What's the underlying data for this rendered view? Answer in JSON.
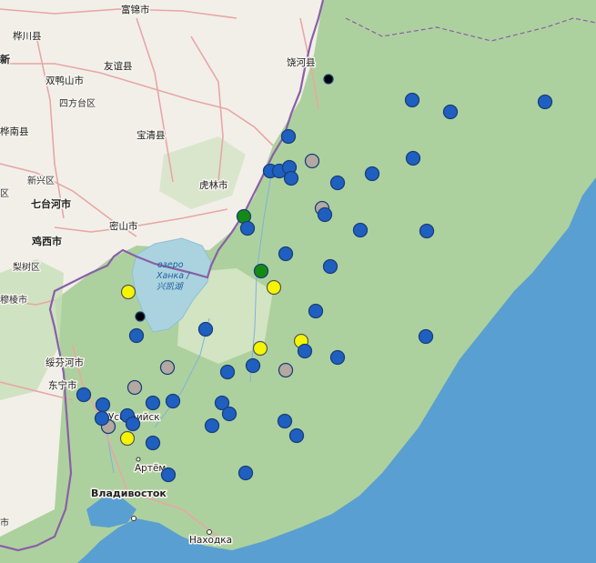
{
  "map": {
    "labels": {
      "fujin": "富锦市",
      "huachuan": "桦川县",
      "shuangyashan_a": "新",
      "youyi": "友谊县",
      "shuangyashan": "双鸭山市",
      "sifangtai": "四方台区",
      "huanan": "桦南县",
      "baoqing": "宝清县",
      "xinxing": "新兴区",
      "qitaihe": "七台河市",
      "qitaihe_a": "区",
      "hulin": "虎林市",
      "mishan": "密山市",
      "jixi": "鸡西市",
      "lishu": "梨树区",
      "muling": "穆棱市",
      "raohe": "饶河县",
      "suifenhe": "绥芬河市",
      "dongning": "东宁市",
      "ussuriysk": "Уссурийск",
      "artem": "Артём",
      "vladivostok": "Владивосток",
      "nakhodka": "Находка",
      "lake_line1": "озеро",
      "lake_line2": "Ханка /",
      "lake_line3": "兴凯湖",
      "edge_shi": "市"
    },
    "colors": {
      "land": "#f2efe9",
      "forest": "#add19e",
      "sea": "#5a9fd1",
      "lake": "#aad3df",
      "border": "#8a5fa8",
      "road": "#e8a6a6",
      "marker_blue": "#1f5fbf",
      "marker_grey": "#b3a9a1",
      "marker_yellow": "#f5f500",
      "marker_green": "#138a13",
      "marker_black": "#000000"
    },
    "markers": [
      {
        "type": "blue"
      },
      {
        "type": "blue"
      },
      {
        "type": "blue"
      },
      {
        "type": "blue"
      },
      {
        "type": "blue"
      },
      {
        "type": "grey"
      },
      {
        "type": "blue"
      },
      {
        "type": "blue"
      },
      {
        "type": "blue"
      },
      {
        "type": "blue"
      },
      {
        "type": "blue"
      },
      {
        "type": "grey"
      },
      {
        "type": "blue"
      },
      {
        "type": "green"
      },
      {
        "type": "blue"
      },
      {
        "type": "blue"
      },
      {
        "type": "blue"
      },
      {
        "type": "blue"
      },
      {
        "type": "green"
      },
      {
        "type": "blue"
      },
      {
        "type": "yellow"
      },
      {
        "type": "yellow"
      },
      {
        "type": "black"
      },
      {
        "type": "black"
      },
      {
        "type": "blue"
      },
      {
        "type": "blue"
      },
      {
        "type": "blue"
      },
      {
        "type": "yellow"
      },
      {
        "type": "blue"
      },
      {
        "type": "yellow"
      },
      {
        "type": "blue"
      },
      {
        "type": "blue"
      },
      {
        "type": "blue"
      },
      {
        "type": "grey"
      },
      {
        "type": "blue"
      },
      {
        "type": "grey"
      },
      {
        "type": "grey"
      },
      {
        "type": "blue"
      },
      {
        "type": "blue"
      },
      {
        "type": "blue"
      },
      {
        "type": "blue"
      },
      {
        "type": "blue"
      },
      {
        "type": "blue"
      },
      {
        "type": "blue"
      },
      {
        "type": "grey"
      },
      {
        "type": "blue"
      },
      {
        "type": "blue"
      },
      {
        "type": "blue"
      },
      {
        "type": "yellow"
      },
      {
        "type": "blue"
      },
      {
        "type": "blue"
      },
      {
        "type": "blue"
      },
      {
        "type": "blue"
      },
      {
        "type": "blue"
      },
      {
        "type": "blue"
      }
    ]
  }
}
